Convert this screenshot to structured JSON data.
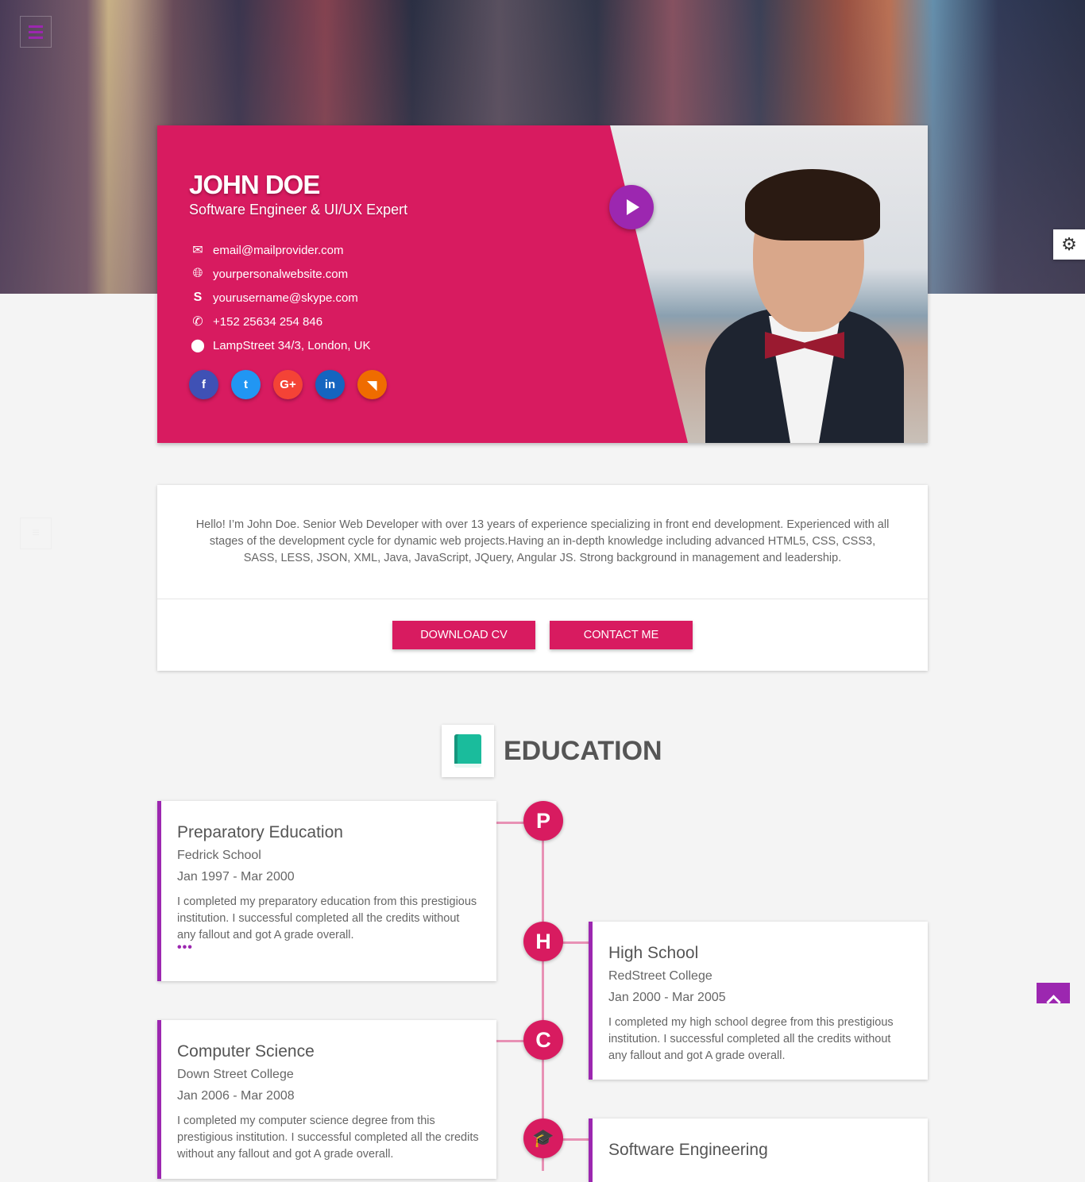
{
  "profile": {
    "name": "JOHN DOE",
    "role": "Software Engineer & UI/UX Expert",
    "contacts": [
      {
        "icon": "email-icon",
        "text": "email@mailprovider.com"
      },
      {
        "icon": "globe-icon",
        "text": "yourpersonalwebsite.com"
      },
      {
        "icon": "skype-icon",
        "text": "yourusername@skype.com"
      },
      {
        "icon": "phone-icon",
        "text": "+152 25634 254 846"
      },
      {
        "icon": "location-icon",
        "text": "LampStreet 34/3, London, UK"
      }
    ],
    "social": [
      {
        "name": "facebook",
        "glyph": "f",
        "color": "#3f51b5"
      },
      {
        "name": "twitter",
        "glyph": "t",
        "color": "#2196f3"
      },
      {
        "name": "google-plus",
        "glyph": "G+",
        "color": "#f44336"
      },
      {
        "name": "linkedin",
        "glyph": "in",
        "color": "#1565c0"
      },
      {
        "name": "rss",
        "glyph": "◥",
        "color": "#ef6c00"
      }
    ]
  },
  "about": {
    "text": "Hello! I’m John Doe. Senior Web Developer with over 13 years of experience specializing in front end development. Experienced with all stages of the development cycle for dynamic web projects.Having an in-depth knowledge including advanced HTML5, CSS, CSS3, SASS, LESS, JSON, XML, Java, JavaScript, JQuery, Angular JS. Strong background in management and leadership.",
    "download_label": "DOWNLOAD CV",
    "contact_label": "CONTACT ME"
  },
  "education": {
    "title": "EDUCATION",
    "items": [
      {
        "badge": "P",
        "title": "Preparatory Education",
        "institution": "Fedrick School",
        "dates": "Jan 1997 - Mar 2000",
        "text": "I completed my preparatory education from this prestigious institution. I successful completed all the credits without any fallout and got A grade overall.",
        "more": "•••"
      },
      {
        "badge": "H",
        "title": "High School",
        "institution": "RedStreet College",
        "dates": "Jan 2000 - Mar 2005",
        "text": "I completed my high school degree from this prestigious institution. I successful completed all the credits without any fallout and got A grade overall."
      },
      {
        "badge": "C",
        "title": "Computer Science",
        "institution": "Down Street College",
        "dates": "Jan 2006 - Mar 2008",
        "text": "I completed my computer science degree from this prestigious institution. I successful completed all the credits without any fallout and got A grade overall."
      },
      {
        "badge": "🎓",
        "title": "Software Engineering"
      }
    ]
  },
  "colors": {
    "primary": "#d81b60",
    "accent": "#9c27b0",
    "timeline": "#e891b5"
  }
}
